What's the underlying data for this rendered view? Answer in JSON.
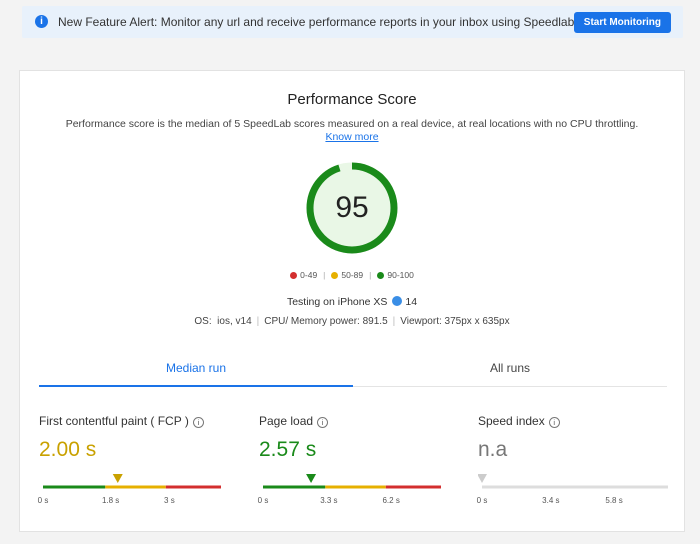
{
  "banner": {
    "message": "New Feature Alert: Monitor any url and receive performance reports in your inbox using Speedlab.",
    "button": "Start Monitoring"
  },
  "score": {
    "title": "Performance Score",
    "subtitle": "Performance score is the median of 5 SpeedLab scores measured on a real device, at real locations with no CPU throttling.",
    "know_more": "Know more",
    "value": "95",
    "ring_color": "#1a8a1a",
    "ring_fill": "#e9f7e6"
  },
  "legend": [
    {
      "label": "0-49",
      "color": "#d32f2f"
    },
    {
      "label": "50-89",
      "color": "#e6b000"
    },
    {
      "label": "90-100",
      "color": "#1a8a1a"
    }
  ],
  "device": {
    "testing_label": "Testing on iPhone XS",
    "app_version": "14",
    "os_label": "OS:",
    "os_value": "ios, v14",
    "cpu_label": "CPU/ Memory power:",
    "cpu_value": "891.5",
    "viewport_label": "Viewport:",
    "viewport_value": "375px x 635px"
  },
  "tabs": {
    "median": "Median run",
    "all": "All runs"
  },
  "metrics": [
    {
      "name": "First contentful paint ( FCP )",
      "value": "2.00 s",
      "value_color": "#c9a100",
      "marker_position": 0.42,
      "segments": [
        [
          "#1a8a1a",
          0.35
        ],
        [
          "#e6b000",
          0.69
        ],
        [
          "#d32f2f",
          1.0
        ]
      ],
      "ticks": [
        [
          "0 s",
          0.0
        ],
        [
          "1.8 s",
          0.38
        ],
        [
          "3 s",
          0.71
        ]
      ]
    },
    {
      "name": "Page load",
      "value": "2.57 s",
      "value_color": "#1a8a1a",
      "marker_position": 0.27,
      "segments": [
        [
          "#1a8a1a",
          0.35
        ],
        [
          "#e6b000",
          0.69
        ],
        [
          "#d32f2f",
          1.0
        ]
      ],
      "ticks": [
        [
          "0 s",
          0.0
        ],
        [
          "3.3 s",
          0.37
        ],
        [
          "6.2 s",
          0.72
        ]
      ]
    },
    {
      "name": "Speed index",
      "value": "n.a",
      "value_color": "#777777",
      "marker_position": 0.0,
      "segments": [
        [
          "#dddddd",
          1.0
        ]
      ],
      "ticks": [
        [
          "0 s",
          0.0
        ],
        [
          "3.4 s",
          0.37
        ],
        [
          "5.8 s",
          0.71
        ]
      ]
    }
  ]
}
